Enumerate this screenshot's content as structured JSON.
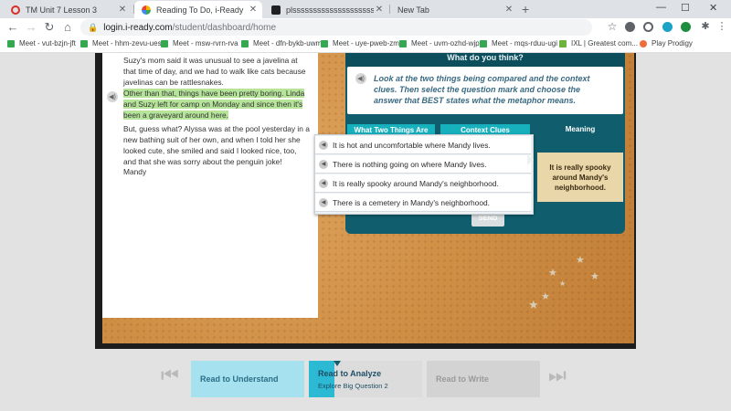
{
  "browser": {
    "tabs": [
      {
        "label": "TM Unit 7 Lesson 3",
        "active": false,
        "favicon_color": "#d93025"
      },
      {
        "label": "Reading To Do, i-Ready",
        "active": true,
        "favicon_color": "#f4b400"
      },
      {
        "label": "plssssssssssssssssssssssss",
        "active": false,
        "favicon_color": "#202124"
      },
      {
        "label": "New Tab",
        "active": false,
        "favicon_color": ""
      }
    ],
    "new_tab": "+",
    "window_controls": {
      "minimize": "—",
      "maximize": "☐",
      "close": "✕"
    },
    "url_host": "login.i-ready.com",
    "url_path": "/student/dashboard/home",
    "bookmarks": [
      {
        "label": "Meet - vut-bzjn-jft",
        "icon_color": "#34a853"
      },
      {
        "label": "Meet - hhm-zevu-ues",
        "icon_color": "#34a853"
      },
      {
        "label": "Meet - msw-rvrn-rva",
        "icon_color": "#34a853"
      },
      {
        "label": "Meet - dfn-bykb-uwm",
        "icon_color": "#34a853"
      },
      {
        "label": "Meet - uye-pweb-zmf",
        "icon_color": "#34a853"
      },
      {
        "label": "Meet - uvm-ozhd-wjp",
        "icon_color": "#34a853"
      },
      {
        "label": "Meet - mqs-rduu-ugi",
        "icon_color": "#34a853"
      },
      {
        "label": "IXL | Greatest com...",
        "icon_color": "#6cb33e"
      },
      {
        "label": "Play Prodigy",
        "icon_color": "#ef6c3a"
      }
    ]
  },
  "passage": {
    "para1": "Suzy's mom said it was unusual to see a javelina at that time of day, and we had to walk like cats because javelinas can be rattlesnakes.",
    "para2": "Other than that, things have been pretty boring. Linda and Suzy left for camp on Monday and since then it's been a graveyard around here.",
    "para3": "But, guess what? Alyssa was at the pool yesterday in a new bathing suit of her own, and when I told her she looked cute, she smiled and said I looked nice, too, and that she was sorry about the penguin joke!",
    "signature": "Mandy"
  },
  "question": {
    "header": "What do you think?",
    "instructions": "Look at the two things being compared and the context clues. Then select the question mark and choose the answer that BEST states what the metaphor means.",
    "columns": [
      "What Two Things Are",
      "Context Clues",
      "Meaning"
    ],
    "meaning_value": "It is really spooky around Mandy's neighborhood.",
    "send_label": "SEND",
    "options": [
      "It is hot and uncomfortable where Mandy lives.",
      "There is nothing going on where Mandy lives.",
      "It is really spooky around Mandy's neighborhood.",
      "There is a cemetery in Mandy's neighborhood."
    ]
  },
  "steps": [
    {
      "label": "Read to Understand",
      "sub": "",
      "state": "done",
      "color": "#a6e1f0",
      "text_color": "#2a6f86"
    },
    {
      "label": "Read to Analyze",
      "sub": "Explore Big Question 2",
      "state": "current",
      "color": "#dcdcdc",
      "text_color": "#1f4f66"
    },
    {
      "label": "Read to Write",
      "sub": "",
      "state": "upcoming",
      "color": "#d3d3d3",
      "text_color": "#9a9a9a"
    }
  ],
  "colors": {
    "teal": "#0f5d6d",
    "column_blue": "#17b0bd",
    "highlight": "#b6e59a",
    "meaning_tan": "#e9d7a9"
  }
}
